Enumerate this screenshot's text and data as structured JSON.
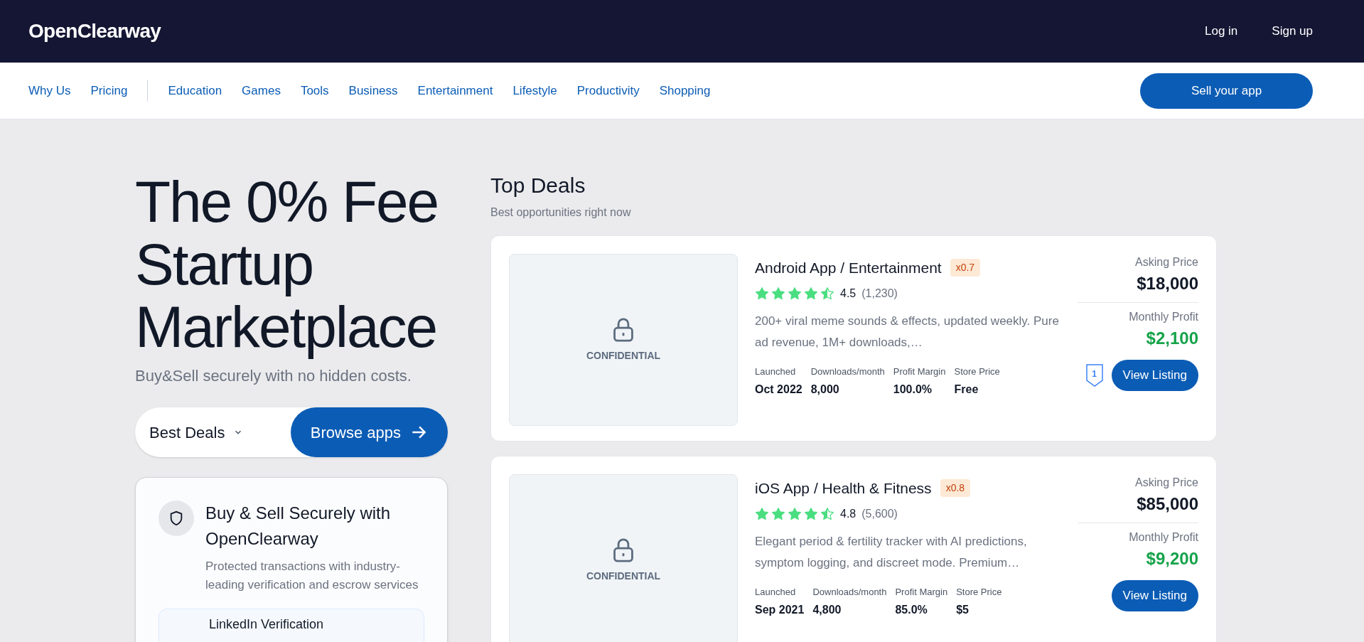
{
  "header": {
    "logo": "OpenClearway",
    "links": [
      "Log in",
      "Sign up"
    ]
  },
  "nav": {
    "primary": [
      "Why Us",
      "Pricing"
    ],
    "categories": [
      "Education",
      "Games",
      "Tools",
      "Business",
      "Entertainment",
      "Lifestyle",
      "Productivity",
      "Shopping"
    ],
    "cta": "Sell your app"
  },
  "hero": {
    "title": "The 0% Fee Startup Marketplace",
    "subtitle": "Buy&Sell securely with no hidden costs.",
    "sort": "Best Deals",
    "browse": "Browse apps"
  },
  "trust_card": {
    "title": "Buy & Sell Securely with OpenClearway",
    "text": "Protected transactions with industry-leading verification and escrow services",
    "item": "LinkedIn Verification"
  },
  "deals": {
    "title": "Top Deals",
    "subtitle": "Best opportunities right now",
    "listings": [
      {
        "image_label": "CONFIDENTIAL",
        "title": "Android App / Entertainment",
        "multiple": "x0.7",
        "stars": 4.5,
        "rating": "4.5",
        "reviews": "(1,230)",
        "description": "200+ viral meme sounds & effects, updated weekly. Pure ad revenue, 1M+ downloads,…",
        "stats": [
          {
            "label": "Launched",
            "value": "Oct 2022"
          },
          {
            "label": "Downloads/month",
            "value": "8,000"
          },
          {
            "label": "Profit Margin",
            "value": "100.0%"
          },
          {
            "label": "Store Price",
            "value": "Free"
          }
        ],
        "asking_label": "Asking Price",
        "asking": "$18,000",
        "profit_label": "Monthly Profit",
        "profit": "$2,100",
        "rank": "1",
        "button": "View Listing"
      },
      {
        "image_label": "CONFIDENTIAL",
        "title": "iOS App / Health & Fitness",
        "multiple": "x0.8",
        "stars": 4.5,
        "rating": "4.8",
        "reviews": "(5,600)",
        "description": "Elegant period & fertility tracker with AI predictions, symptom logging, and discreet mode. Premium…",
        "stats": [
          {
            "label": "Launched",
            "value": "Sep 2021"
          },
          {
            "label": "Downloads/month",
            "value": "4,800"
          },
          {
            "label": "Profit Margin",
            "value": "85.0%"
          },
          {
            "label": "Store Price",
            "value": "$5"
          }
        ],
        "asking_label": "Asking Price",
        "asking": "$85,000",
        "profit_label": "Monthly Profit",
        "profit": "$9,200",
        "button": "View Listing"
      }
    ]
  }
}
